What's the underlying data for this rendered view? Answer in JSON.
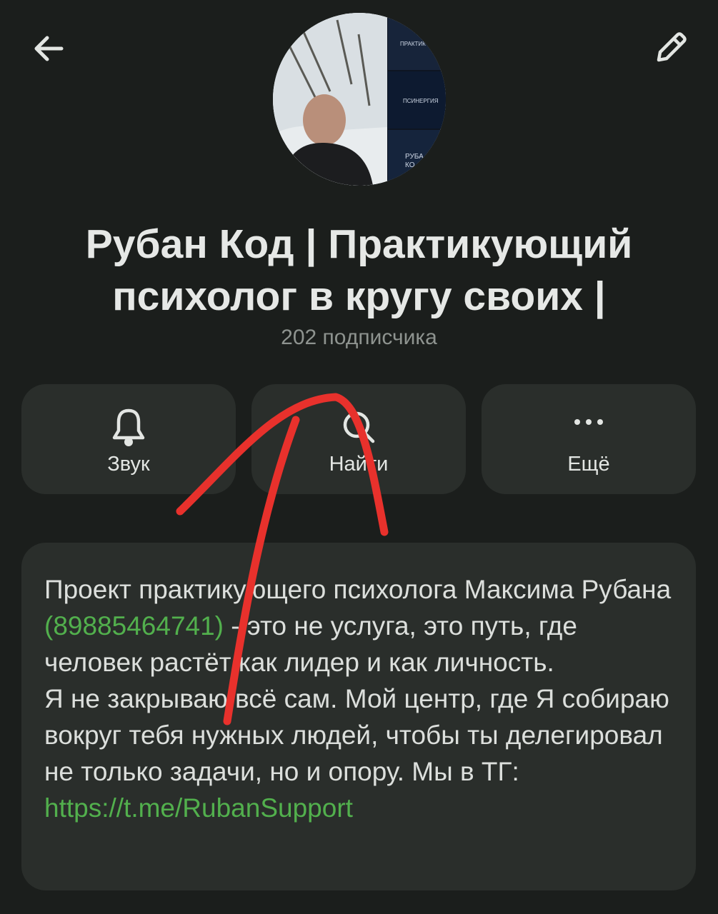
{
  "header": {
    "back_icon": "arrow-left-icon",
    "edit_icon": "pencil-icon"
  },
  "channel": {
    "title_line1": "Рубан Код | Практикующий",
    "title_line2": "психолог в кругу своих |",
    "subscribers": "202 подписчика",
    "avatar": {
      "tile1_text": "ПРАКТИК",
      "tile2_text": "ПСИНЕРГИЯ",
      "tile3_text_line1": "РУБА",
      "tile3_text_line2": "КО"
    }
  },
  "actions": [
    {
      "label": "Звук",
      "icon": "bell-icon"
    },
    {
      "label": "Найти",
      "icon": "search-icon"
    },
    {
      "label": "Ещё",
      "icon": "more-dots-icon"
    }
  ],
  "about": {
    "text_part1": "Проект практикующего психолога Максима Рубана ",
    "phone": "(89885464741)",
    "text_part2": " -  это не услуга, это путь, где человек растёт как лидер и как личность.",
    "text_part3": "Я не закрываю всё сам. Мой центр, где Я собираю вокруг тебя нужных людей, чтобы ты делегировал не только задачи, но и опору. Мы в ТГ: ",
    "link": "https://t.me/RubanSupport"
  },
  "colors": {
    "background": "#1b1e1c",
    "card": "#2a2e2b",
    "accent_green": "#52b04d",
    "annotation_red": "#e8312c"
  }
}
